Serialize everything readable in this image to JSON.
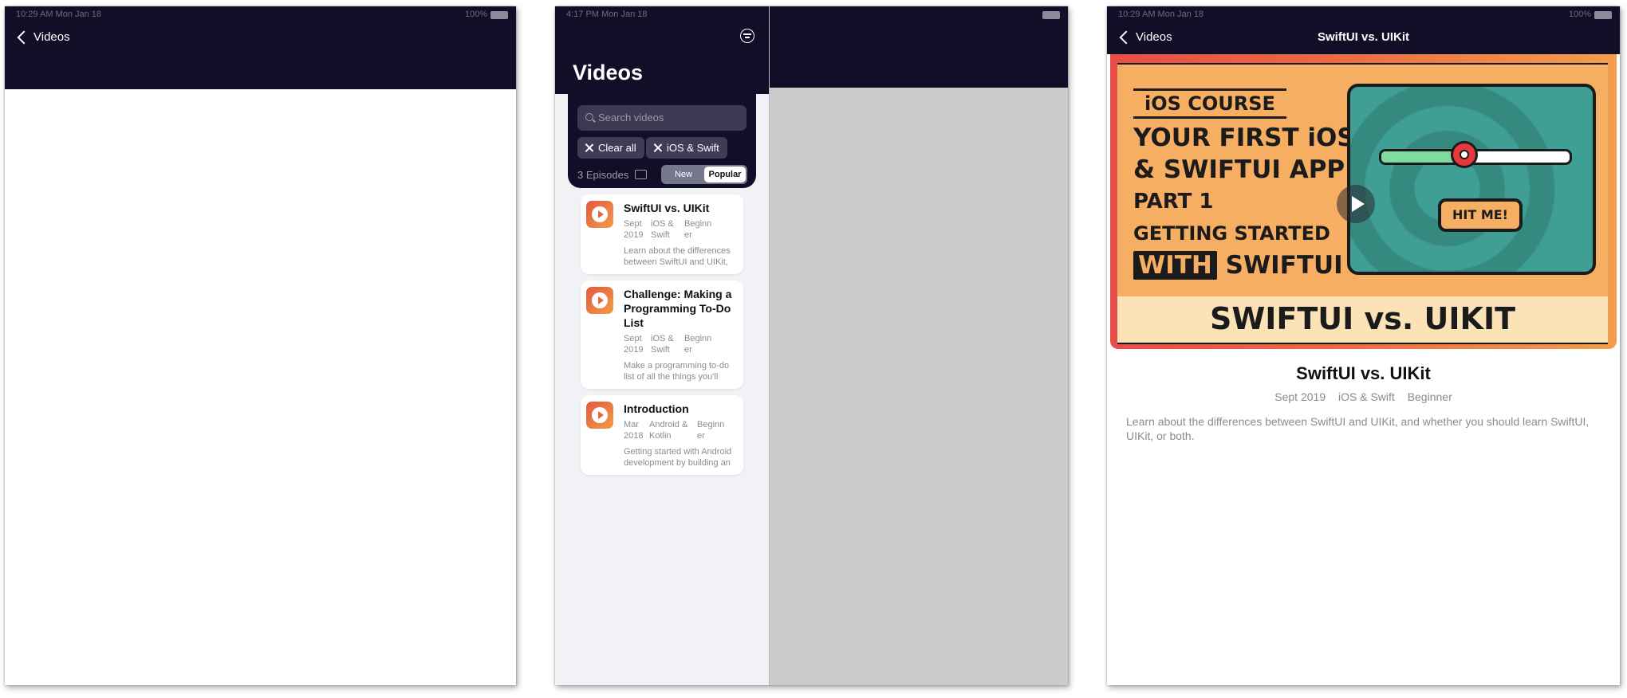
{
  "status_bar": {
    "left_time_date": "10:29 AM   Mon Jan 18",
    "middle_time_date": "4:17 PM   Mon Jan 18",
    "battery": "100%"
  },
  "screen_left": {
    "back_label": "Videos"
  },
  "screen_middle": {
    "title": "Videos",
    "search_placeholder": "Search videos",
    "chips": [
      {
        "label": "Clear all"
      },
      {
        "label": "iOS & Swift"
      }
    ],
    "episodes_count": "3 Episodes",
    "sort": {
      "options": [
        "New",
        "Popular"
      ],
      "selected": "Popular"
    },
    "cards": [
      {
        "title": "SwiftUI vs. UIKit",
        "date": "Sept 2019",
        "platform": "iOS & Swift",
        "level": "Beginner",
        "description": "Learn about the differences between SwiftUI and UIKit, and whether you should learn SwiftUI, UIKit, or both."
      },
      {
        "title": "Challenge: Making a Programming To-Do List",
        "date": "Sept 2019",
        "platform": "iOS & Swift",
        "level": "Beginner",
        "description": "Make a programming to-do list of all the things you'll need to do to build the game."
      },
      {
        "title": "Introduction",
        "date": "Mar 2018",
        "platform": "Android & Kotlin",
        "level": "Beginner",
        "description": "Getting started with Android development by building an app."
      }
    ]
  },
  "screen_right": {
    "back_label": "Videos",
    "nav_title": "SwiftUI vs. UIKit",
    "artwork": {
      "lines": [
        "iOS COURSE",
        "YOUR FIRST iOS",
        "& SWIFTUI APP",
        "PART 1",
        "GETTING STARTED",
        "WITH",
        "SWIFTUI"
      ],
      "button_text": "HIT ME!",
      "band_text": "SWIFTUI vs. UIKIT",
      "slider_level": 0.42
    },
    "title": "SwiftUI vs. UIKit",
    "meta": {
      "date": "Sept 2019",
      "platform": "iOS & Swift",
      "level": "Beginner"
    },
    "description": "Learn about the differences between SwiftUI and UIKit, and whether you should learn SwiftUI, UIKit, or both."
  },
  "colors": {
    "nav_background": "#110f27",
    "accent_gradient_start": "#e2593d",
    "accent_gradient_end": "#f29b4b",
    "secondary_text": "#8a8a90"
  },
  "icons": {
    "back": "chevron-left-icon",
    "filter": "filter-icon",
    "search": "search-icon",
    "chip_remove": "close-icon",
    "episodes": "download-icon",
    "play": "play-icon"
  }
}
